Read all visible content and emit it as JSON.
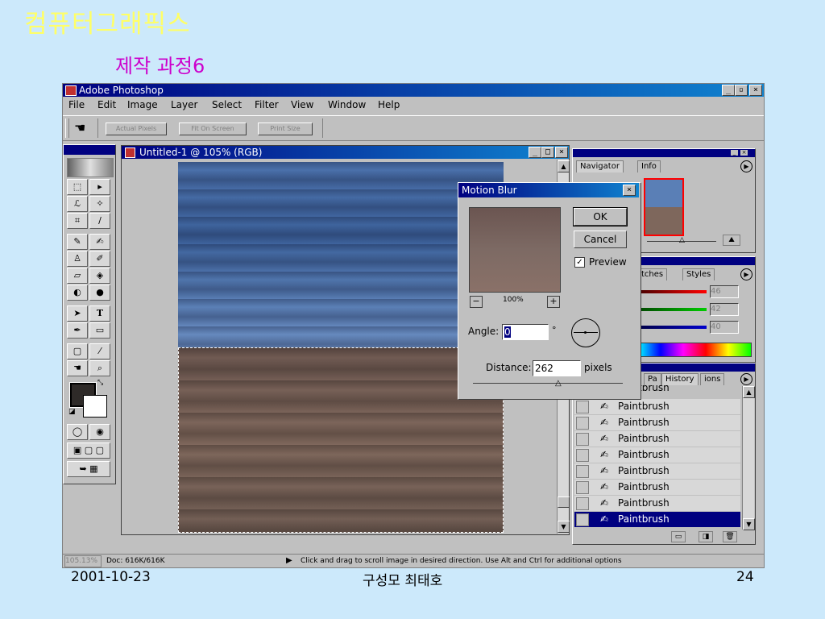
{
  "slide": {
    "title": "컴퓨터그래픽스",
    "subtitle": "제작 과정6",
    "footer_date": "2001-10-23",
    "footer_author": "구성모 최태호",
    "footer_page": "24"
  },
  "app": {
    "title": "Adobe Photoshop",
    "menu": [
      "File",
      "Edit",
      "Image",
      "Layer",
      "Select",
      "Filter",
      "View",
      "Window",
      "Help"
    ],
    "options": [
      "Actual Pixels",
      "Fit On Screen",
      "Print Size"
    ]
  },
  "document": {
    "title": "Untitled-1 @ 105% (RGB)"
  },
  "dialog": {
    "title": "Motion Blur",
    "ok_label": "OK",
    "cancel_label": "Cancel",
    "preview_label": "Preview",
    "zoom": "100%",
    "angle_label": "Angle:",
    "angle_value": "0",
    "angle_unit": "°",
    "distance_label": "Distance:",
    "distance_value": "262",
    "distance_unit": "pixels"
  },
  "navigator": {
    "tab_navigator": "Navigator",
    "tab_info": "Info"
  },
  "color": {
    "tab_swatches": "tches",
    "tab_styles": "Styles",
    "r": "46",
    "g": "42",
    "b": "40"
  },
  "history": {
    "tab_pa": "Pa",
    "tab_history": "History",
    "tab_actions": "ions",
    "partial_item": "Paintbrush",
    "items": [
      "Paintbrush",
      "Paintbrush",
      "Paintbrush",
      "Paintbrush",
      "Paintbrush",
      "Paintbrush",
      "Paintbrush",
      "Paintbrush"
    ]
  },
  "status": {
    "zoom": "105.13%",
    "doc": "Doc: 616K/616K",
    "message": "Click and drag to scroll image in desired direction.  Use Alt and Ctrl for additional options"
  }
}
